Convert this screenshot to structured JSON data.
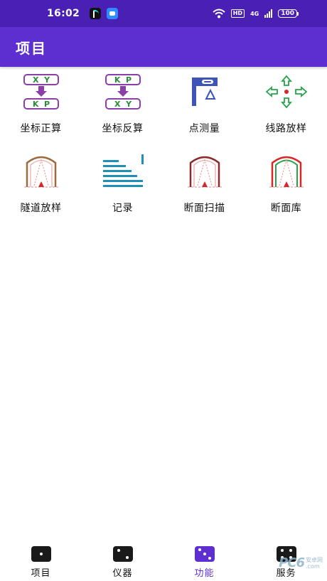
{
  "status": {
    "time": "16:02",
    "battery": "100",
    "hd": "HD",
    "signal_label": "4G"
  },
  "appbar": {
    "title": "项目"
  },
  "tiles": [
    {
      "label": "坐标正算",
      "icon": "xy-to-kp-icon"
    },
    {
      "label": "坐标反算",
      "icon": "kp-to-xy-icon"
    },
    {
      "label": "点测量",
      "icon": "point-measure-icon"
    },
    {
      "label": "线路放样",
      "icon": "route-stakeout-icon"
    },
    {
      "label": "隧道放样",
      "icon": "tunnel-stakeout-icon"
    },
    {
      "label": "记录",
      "icon": "record-list-icon"
    },
    {
      "label": "断面扫描",
      "icon": "section-scan-icon"
    },
    {
      "label": "断面库",
      "icon": "section-library-icon"
    }
  ],
  "convert_icons": {
    "forward_top": "X  Y",
    "forward_bottom": "K  P",
    "inverse_top": "K  P",
    "inverse_bottom": "X  Y"
  },
  "bottom_nav": [
    {
      "label": "项目",
      "active": false
    },
    {
      "label": "仪器",
      "active": false
    },
    {
      "label": "功能",
      "active": true
    },
    {
      "label": "服务",
      "active": false
    }
  ],
  "watermark": {
    "logo": "PC6",
    "line1": "安卓网",
    "line2": ".com"
  },
  "colors": {
    "status_bar": "#4a1fb4",
    "app_bar": "#5d2fd0",
    "accent": "#5d2fd0",
    "convert_box": "#8b3fa8",
    "route_arrow": "#27a34a",
    "record_lines": "#1f8fb8"
  }
}
